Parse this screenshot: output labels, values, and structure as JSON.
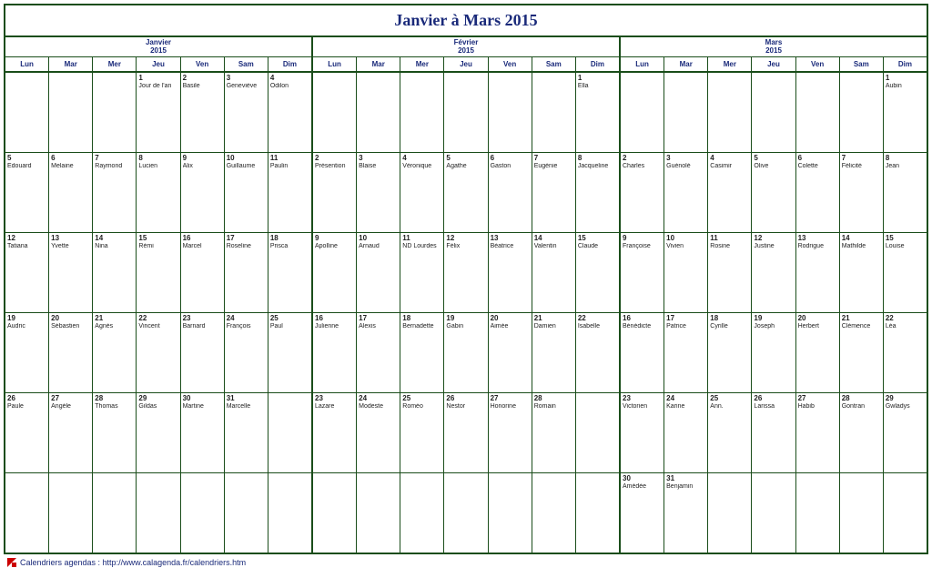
{
  "title": "Janvier à Mars 2015",
  "dow": [
    "Lun",
    "Mar",
    "Mer",
    "Jeu",
    "Ven",
    "Sam",
    "Dim"
  ],
  "months": [
    {
      "name": "Janvier",
      "year": "2015",
      "weeks": [
        [
          {},
          {},
          {},
          {
            "n": "1",
            "s": "Jour de l'an"
          },
          {
            "n": "2",
            "s": "Basile"
          },
          {
            "n": "3",
            "s": "Geneviève"
          },
          {
            "n": "4",
            "s": "Odilon"
          }
        ],
        [
          {
            "n": "5",
            "s": "Edouard"
          },
          {
            "n": "6",
            "s": "Melaine"
          },
          {
            "n": "7",
            "s": "Raymond"
          },
          {
            "n": "8",
            "s": "Lucien"
          },
          {
            "n": "9",
            "s": "Alix"
          },
          {
            "n": "10",
            "s": "Guillaume"
          },
          {
            "n": "11",
            "s": "Paulin"
          }
        ],
        [
          {
            "n": "12",
            "s": "Tatiana"
          },
          {
            "n": "13",
            "s": "Yvette"
          },
          {
            "n": "14",
            "s": "Nina"
          },
          {
            "n": "15",
            "s": "Rémi"
          },
          {
            "n": "16",
            "s": "Marcel"
          },
          {
            "n": "17",
            "s": "Roseline"
          },
          {
            "n": "18",
            "s": "Prisca"
          }
        ],
        [
          {
            "n": "19",
            "s": "Audric"
          },
          {
            "n": "20",
            "s": "Sébastien"
          },
          {
            "n": "21",
            "s": "Agnès"
          },
          {
            "n": "22",
            "s": "Vincent"
          },
          {
            "n": "23",
            "s": "Barnard"
          },
          {
            "n": "24",
            "s": "François"
          },
          {
            "n": "25",
            "s": "Paul"
          }
        ],
        [
          {
            "n": "26",
            "s": "Paule"
          },
          {
            "n": "27",
            "s": "Angèle"
          },
          {
            "n": "28",
            "s": "Thomas"
          },
          {
            "n": "29",
            "s": "Gildas"
          },
          {
            "n": "30",
            "s": "Martine"
          },
          {
            "n": "31",
            "s": "Marcelle"
          },
          {}
        ],
        [
          {},
          {},
          {},
          {},
          {},
          {},
          {}
        ]
      ]
    },
    {
      "name": "Février",
      "year": "2015",
      "weeks": [
        [
          {},
          {},
          {},
          {},
          {},
          {},
          {
            "n": "1",
            "s": "Ella"
          }
        ],
        [
          {
            "n": "2",
            "s": "Présention"
          },
          {
            "n": "3",
            "s": "Blaise"
          },
          {
            "n": "4",
            "s": "Véronique"
          },
          {
            "n": "5",
            "s": "Agathe"
          },
          {
            "n": "6",
            "s": "Gaston"
          },
          {
            "n": "7",
            "s": "Eugénie"
          },
          {
            "n": "8",
            "s": "Jacqueline"
          }
        ],
        [
          {
            "n": "9",
            "s": "Apolline"
          },
          {
            "n": "10",
            "s": "Arnaud"
          },
          {
            "n": "11",
            "s": "ND Lourdes"
          },
          {
            "n": "12",
            "s": "Félix"
          },
          {
            "n": "13",
            "s": "Béatrice"
          },
          {
            "n": "14",
            "s": "Valentin"
          },
          {
            "n": "15",
            "s": "Claude"
          }
        ],
        [
          {
            "n": "16",
            "s": "Julienne"
          },
          {
            "n": "17",
            "s": "Alexis"
          },
          {
            "n": "18",
            "s": "Bernadette"
          },
          {
            "n": "19",
            "s": "Gabin"
          },
          {
            "n": "20",
            "s": "Aimée"
          },
          {
            "n": "21",
            "s": "Damien"
          },
          {
            "n": "22",
            "s": "Isabelle"
          }
        ],
        [
          {
            "n": "23",
            "s": "Lazare"
          },
          {
            "n": "24",
            "s": "Modeste"
          },
          {
            "n": "25",
            "s": "Roméo"
          },
          {
            "n": "26",
            "s": "Nestor"
          },
          {
            "n": "27",
            "s": "Honorine"
          },
          {
            "n": "28",
            "s": "Romain"
          },
          {}
        ],
        [
          {},
          {},
          {},
          {},
          {},
          {},
          {}
        ]
      ]
    },
    {
      "name": "Mars",
      "year": "2015",
      "weeks": [
        [
          {},
          {},
          {},
          {},
          {},
          {},
          {
            "n": "1",
            "s": "Aubin"
          }
        ],
        [
          {
            "n": "2",
            "s": "Charles"
          },
          {
            "n": "3",
            "s": "Guénolé"
          },
          {
            "n": "4",
            "s": "Casimir"
          },
          {
            "n": "5",
            "s": "Olive"
          },
          {
            "n": "6",
            "s": "Colette"
          },
          {
            "n": "7",
            "s": "Félicité"
          },
          {
            "n": "8",
            "s": "Jean"
          }
        ],
        [
          {
            "n": "9",
            "s": "Françoise"
          },
          {
            "n": "10",
            "s": "Vivien"
          },
          {
            "n": "11",
            "s": "Rosine"
          },
          {
            "n": "12",
            "s": "Justine"
          },
          {
            "n": "13",
            "s": "Rodrigue"
          },
          {
            "n": "14",
            "s": "Mathilde"
          },
          {
            "n": "15",
            "s": "Louise"
          }
        ],
        [
          {
            "n": "16",
            "s": "Bénédicte"
          },
          {
            "n": "17",
            "s": "Patrice"
          },
          {
            "n": "18",
            "s": "Cyrille"
          },
          {
            "n": "19",
            "s": "Joseph"
          },
          {
            "n": "20",
            "s": "Herbert"
          },
          {
            "n": "21",
            "s": "Clémence"
          },
          {
            "n": "22",
            "s": "Léa"
          }
        ],
        [
          {
            "n": "23",
            "s": "Victorien"
          },
          {
            "n": "24",
            "s": "Karine"
          },
          {
            "n": "25",
            "s": "Ann."
          },
          {
            "n": "26",
            "s": "Larissa"
          },
          {
            "n": "27",
            "s": "Habib"
          },
          {
            "n": "28",
            "s": "Gontran"
          },
          {
            "n": "29",
            "s": "Gwladys"
          }
        ],
        [
          {
            "n": "30",
            "s": "Amédée"
          },
          {
            "n": "31",
            "s": "Benjamin"
          },
          {},
          {},
          {},
          {},
          {}
        ]
      ]
    }
  ],
  "footer": "Calendriers agendas : http://www.calagenda.fr/calendriers.htm"
}
